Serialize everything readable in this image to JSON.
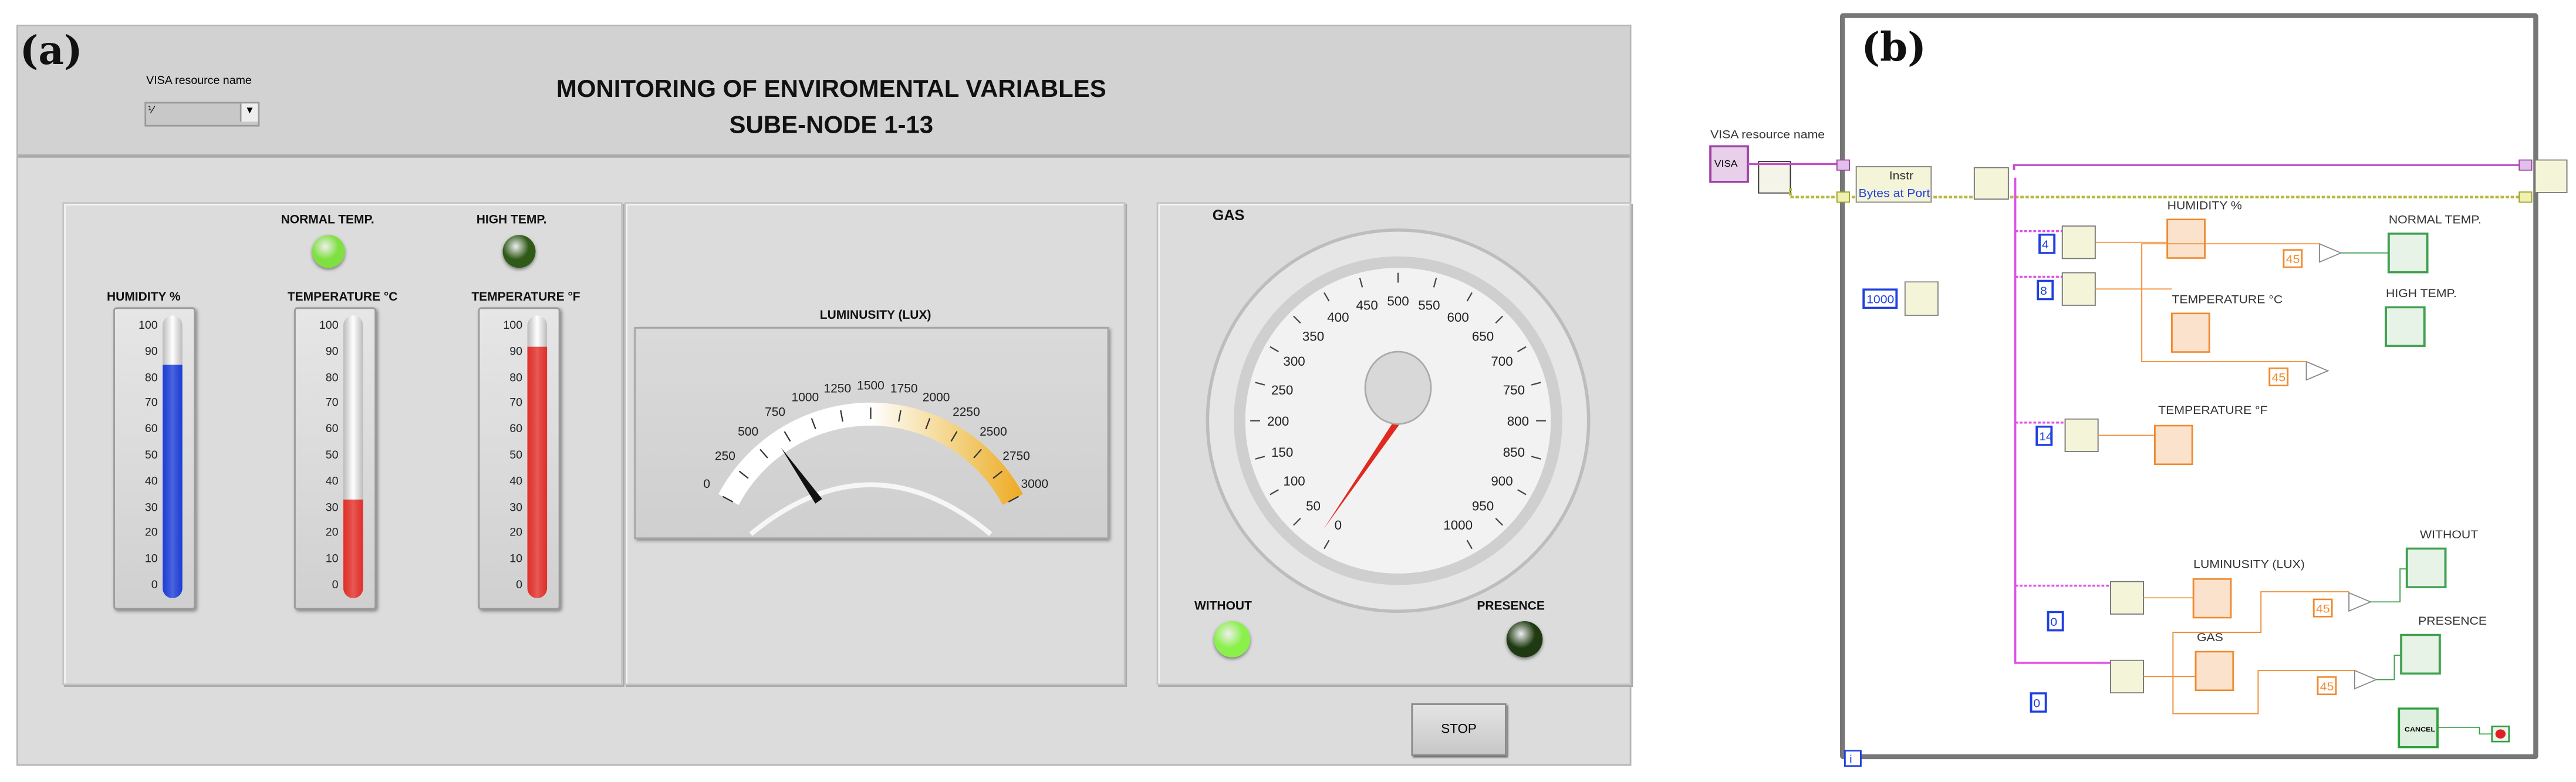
{
  "panel_a": {
    "label": "(a)",
    "visa": {
      "label": "VISA resource name",
      "value": "",
      "icon": "io-icon"
    },
    "title": "MONITORING OF ENVIROMENTAL VARIABLES",
    "subtitle": "SUBE-NODE 1-13",
    "leds": {
      "normal_temp": {
        "label": "NORMAL TEMP.",
        "on": true,
        "color": "#7fe040"
      },
      "high_temp": {
        "label": "HIGH TEMP.",
        "on": false,
        "color": "#2f5a17"
      },
      "without": {
        "label": "WITHOUT",
        "on": true,
        "color": "#8af04a"
      },
      "presence": {
        "label": "PRESENCE",
        "on": false,
        "color": "#1f3a12"
      }
    },
    "thermometers": [
      {
        "label": "HUMIDITY %",
        "value": 85,
        "color": "#1d3ed8",
        "ticks": [
          "0",
          "10",
          "20",
          "30",
          "40",
          "50",
          "60",
          "70",
          "80",
          "90",
          "100"
        ]
      },
      {
        "label": "TEMPERATURE °C",
        "value": 33,
        "color": "#e2302a",
        "ticks": [
          "0",
          "10",
          "20",
          "30",
          "40",
          "50",
          "60",
          "70",
          "80",
          "90",
          "100"
        ]
      },
      {
        "label": "TEMPERATURE °F",
        "value": 92,
        "color": "#e2302a",
        "ticks": [
          "0",
          "10",
          "20",
          "30",
          "40",
          "50",
          "60",
          "70",
          "80",
          "90",
          "100"
        ]
      }
    ],
    "luminosity": {
      "label": "LUMINUSITY (LUX)",
      "value": 650,
      "min": 0,
      "max": 3000,
      "ticks": [
        "0",
        "250",
        "500",
        "750",
        "1000",
        "1250",
        "1500",
        "1750",
        "2000",
        "2250",
        "2500",
        "2750",
        "3000"
      ]
    },
    "gas": {
      "label": "GAS",
      "value": 15,
      "min": 0,
      "max": 1000,
      "ticks": [
        "0",
        "50",
        "100",
        "150",
        "200",
        "250",
        "300",
        "350",
        "400",
        "450",
        "500",
        "550",
        "600",
        "650",
        "700",
        "750",
        "800",
        "850",
        "900",
        "950",
        "1000"
      ]
    },
    "stop_label": "STOP"
  },
  "panel_b": {
    "label": "(b)",
    "visa_label": "VISA resource name",
    "visa_const": "VISA",
    "property_node": {
      "class": "Instr",
      "property": "Bytes at Port"
    },
    "wait_ms": "1000",
    "indices": [
      "4",
      "8",
      "14",
      "0",
      "0"
    ],
    "thresholds": [
      "45",
      "45",
      "45",
      "45"
    ],
    "indicators": [
      "HUMIDITY %",
      "TEMPERATURE °C",
      "TEMPERATURE °F",
      "LUMINUSITY (LUX)",
      "GAS",
      "NORMAL TEMP.",
      "HIGH TEMP.",
      "WITHOUT",
      "PRESENCE"
    ],
    "loop_iter": "i",
    "cancel_label": "CANCEL"
  }
}
